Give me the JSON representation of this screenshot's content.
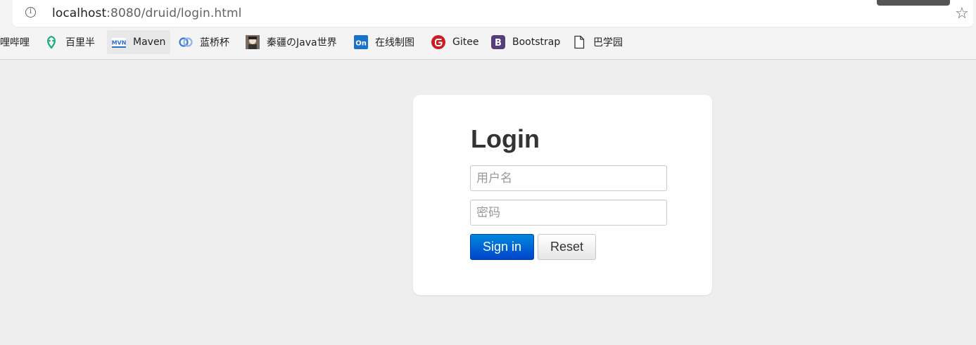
{
  "browser": {
    "url_host": "localhost",
    "url_path": ":8080/druid/login.html",
    "bookmarks": [
      {
        "label": "哩哔哩",
        "icon": "none"
      },
      {
        "label": "百里半",
        "icon": "leaf-icon"
      },
      {
        "label": "Maven",
        "icon": "maven-icon"
      },
      {
        "label": "蓝桥杯",
        "icon": "lanqiao-icon"
      },
      {
        "label": "秦疆のJava世界",
        "icon": "avatar-icon"
      },
      {
        "label": "在线制图",
        "icon": "processon-icon"
      },
      {
        "label": "Gitee",
        "icon": "gitee-icon"
      },
      {
        "label": "Bootstrap",
        "icon": "bootstrap-icon"
      },
      {
        "label": "巴学园",
        "icon": "page-icon"
      }
    ]
  },
  "login": {
    "title": "Login",
    "username_placeholder": "用户名",
    "password_placeholder": "密码",
    "signin_label": "Sign in",
    "reset_label": "Reset"
  },
  "colors": {
    "page_bg": "#eeeeee",
    "primary": "#0055cc",
    "maven_blue": "#2d6fc7",
    "gitee_red": "#c71d23",
    "bootstrap_purple": "#563d7c",
    "processon_blue": "#1a73c8",
    "leaf_green": "#1aad7a"
  }
}
